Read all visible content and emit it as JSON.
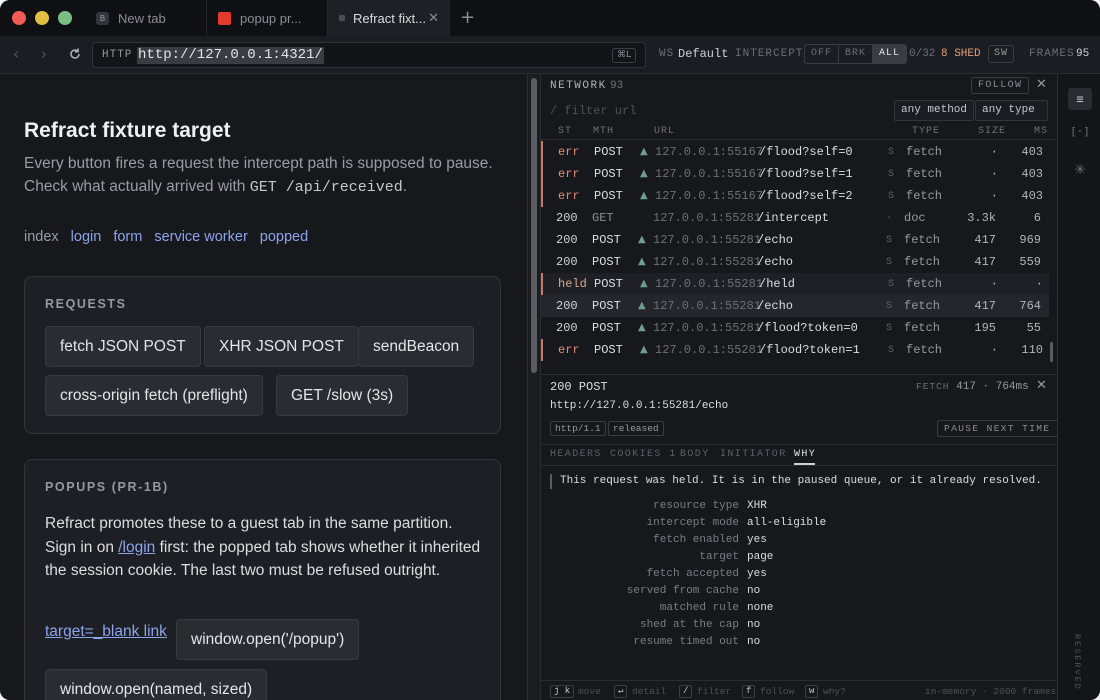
{
  "tabs": [
    {
      "label": "New tab",
      "favicon": "B"
    },
    {
      "label": "popup pr..."
    },
    {
      "label": "Refract fixt..."
    }
  ],
  "toolbar": {
    "scheme": "HTTP",
    "url": "http://127.0.0.1:4321/",
    "url_shortcut": "⌘L",
    "ws_label": "WS",
    "ws_value": "Default",
    "intercept_label": "INTERCEPT",
    "intercept_modes": [
      "OFF",
      "BRK",
      "ALL"
    ],
    "intercept_selected": "ALL",
    "queue_count": "0/32",
    "shed": "8 SHED",
    "sw_label": "SW",
    "frames_label": "FRAMES",
    "frames_value": "95"
  },
  "page": {
    "title": "Refract fixture target",
    "lede_part1": "Every button fires a request the intercept path is supposed to pause. Check what actually arrived with ",
    "lede_code": "GET /api/received",
    "lede_part2": ".",
    "nav": {
      "current": "index",
      "links": [
        "login",
        "form",
        "service worker",
        "popped"
      ]
    },
    "requests_heading": "REQUESTS",
    "request_buttons": [
      "fetch JSON POST",
      "XHR JSON POST",
      "sendBeacon",
      "cross-origin fetch (preflight)",
      "GET /slow (3s)"
    ],
    "popups_heading": "POPUPS (PR-1B)",
    "popups_text1": "Refract promotes these to a guest tab in the same partition. Sign in on ",
    "popups_link": "/login",
    "popups_text2": " first: the popped tab shows whether it inherited the session cookie. The last two must be refused outright.",
    "blank_link": "target=_blank link",
    "popup_buttons": [
      "window.open('/popup')",
      "window.open(named, sized)"
    ]
  },
  "network": {
    "title": "NETWORK",
    "count": "93",
    "follow_label": "FOLLOW",
    "filter_placeholder": "/ filter url",
    "method_filter": "any method",
    "type_filter": "any type",
    "columns": [
      "ST",
      "MTH",
      "URL",
      "TYPE",
      "SIZE",
      "MS"
    ],
    "rows": [
      {
        "st": "err",
        "method": "POST",
        "host": "127.0.0.1:55167",
        "path": "/flood?self=0",
        "s": "S",
        "type": "fetch",
        "size": "·",
        "ms": "403"
      },
      {
        "st": "err",
        "method": "POST",
        "host": "127.0.0.1:55167",
        "path": "/flood?self=1",
        "s": "S",
        "type": "fetch",
        "size": "·",
        "ms": "403"
      },
      {
        "st": "err",
        "method": "POST",
        "host": "127.0.0.1:55167",
        "path": "/flood?self=2",
        "s": "S",
        "type": "fetch",
        "size": "·",
        "ms": "403"
      },
      {
        "st": "200",
        "method": "GET",
        "host": "127.0.0.1:55281",
        "path": "/intercept",
        "s": "·",
        "type": "doc",
        "size": "3.3k",
        "ms": "6"
      },
      {
        "st": "200",
        "method": "POST",
        "host": "127.0.0.1:55281",
        "path": "/echo",
        "s": "S",
        "type": "fetch",
        "size": "417",
        "ms": "969"
      },
      {
        "st": "200",
        "method": "POST",
        "host": "127.0.0.1:55281",
        "path": "/echo",
        "s": "S",
        "type": "fetch",
        "size": "417",
        "ms": "559"
      },
      {
        "st": "held",
        "method": "POST",
        "host": "127.0.0.1:55281",
        "path": "/held",
        "s": "S",
        "type": "fetch",
        "size": "·",
        "ms": "·"
      },
      {
        "st": "200",
        "method": "POST",
        "host": "127.0.0.1:55281",
        "path": "/echo",
        "s": "S",
        "type": "fetch",
        "size": "417",
        "ms": "764"
      },
      {
        "st": "200",
        "method": "POST",
        "host": "127.0.0.1:55281",
        "path": "/flood?token=0",
        "s": "S",
        "type": "fetch",
        "size": "195",
        "ms": "55"
      },
      {
        "st": "err",
        "method": "POST",
        "host": "127.0.0.1:55281",
        "path": "/flood?token=1",
        "s": "S",
        "type": "fetch",
        "size": "·",
        "ms": "110"
      }
    ],
    "detail": {
      "status": "200 POST",
      "type_label": "FETCH",
      "size_time": "417 · 764ms",
      "url": "http://127.0.0.1:55281/echo",
      "chips": [
        "http/1.1",
        "released"
      ],
      "pause_next": "PAUSE NEXT TIME",
      "tabs": [
        "HEADERS",
        "COOKIES 1",
        "BODY",
        "INITIATOR",
        "WHY"
      ],
      "active_tab": "WHY",
      "why_text": "This request was held. It is in the paused queue, or it already resolved.",
      "why_rows": [
        {
          "k": "resource type",
          "v": "XHR"
        },
        {
          "k": "intercept mode",
          "v": "all-eligible"
        },
        {
          "k": "fetch enabled",
          "v": "yes"
        },
        {
          "k": "target",
          "v": "page"
        },
        {
          "k": "fetch accepted",
          "v": "yes"
        },
        {
          "k": "served from cache",
          "v": "no"
        },
        {
          "k": "matched rule",
          "v": "none"
        },
        {
          "k": "shed at the cap",
          "v": "no"
        },
        {
          "k": "resume timed out",
          "v": "no"
        }
      ]
    },
    "status_keys": [
      {
        "key": "j k",
        "hint": "move"
      },
      {
        "key": "↵",
        "hint": "detail"
      },
      {
        "key": "/",
        "hint": "filter"
      },
      {
        "key": "f",
        "hint": "follow"
      },
      {
        "key": "w",
        "hint": "why?"
      }
    ],
    "status_right": "in-memory · 2000 frames"
  },
  "rail": {
    "reserved": "RESERVED",
    "icons": [
      "network-icon",
      "brackets-icon",
      "asterisk-icon"
    ]
  }
}
